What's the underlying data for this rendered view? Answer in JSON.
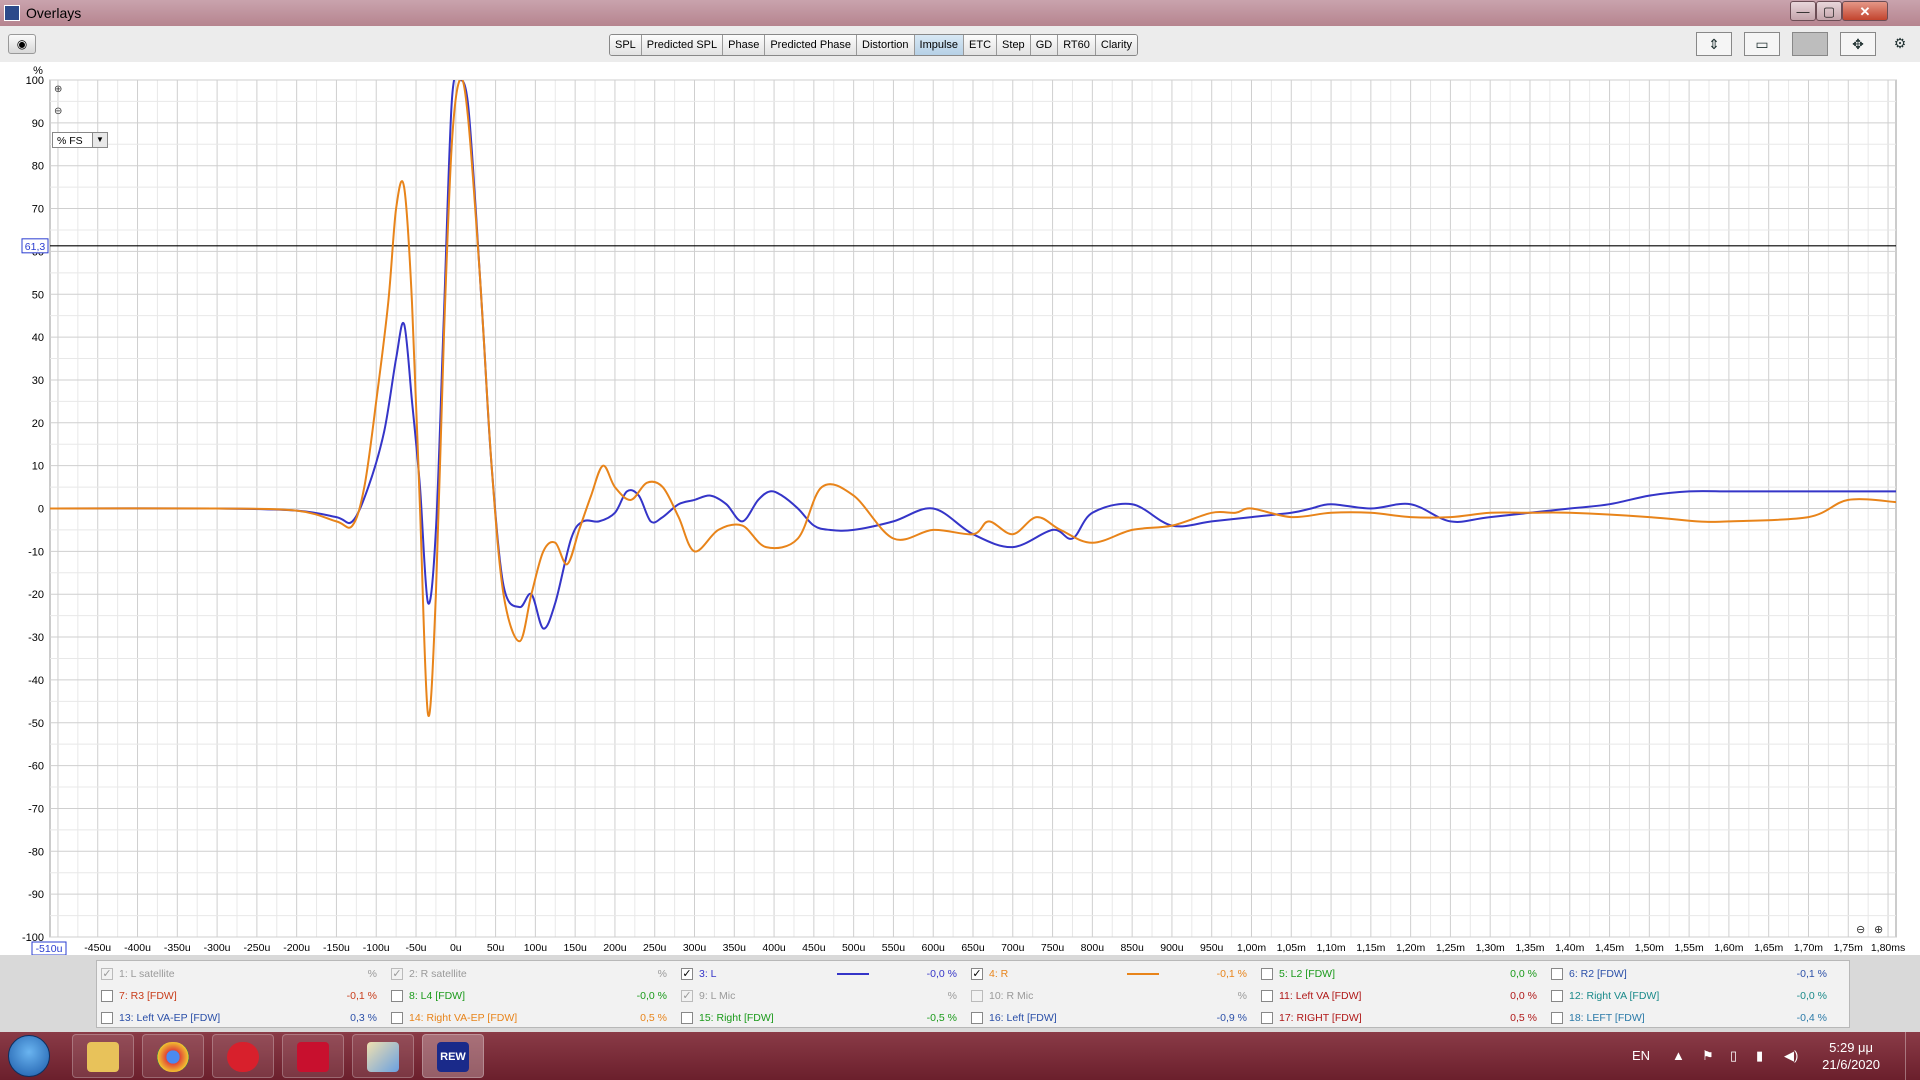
{
  "window": {
    "title": "Overlays",
    "minimize": "—",
    "maximize": "▢",
    "close": "✕"
  },
  "toolbar": {
    "tabs": [
      {
        "label": "SPL"
      },
      {
        "label": "Predicted SPL"
      },
      {
        "label": "Phase"
      },
      {
        "label": "Predicted Phase"
      },
      {
        "label": "Distortion"
      },
      {
        "label": "Impulse",
        "active": true
      },
      {
        "label": "ETC"
      },
      {
        "label": "Step"
      },
      {
        "label": "GD"
      },
      {
        "label": "RT60"
      },
      {
        "label": "Clarity"
      }
    ]
  },
  "graph": {
    "y_unit_label": "%",
    "y_mode": "% FS",
    "cursor_value": "61,3",
    "x_start_label": "-510u"
  },
  "chart_data": {
    "type": "line",
    "xlabel": "",
    "ylabel": "%",
    "xlim": [
      -510,
      1810
    ],
    "ylim": [
      -100,
      100
    ],
    "x_unit": "microseconds",
    "cursor_y": 61.3,
    "grid": true,
    "y_ticks": [
      "100",
      "90",
      "80",
      "70",
      "60",
      "50",
      "40",
      "30",
      "20",
      "10",
      "0",
      "-10",
      "-20",
      "-30",
      "-40",
      "-50",
      "-60",
      "-70",
      "-80",
      "-90",
      "-100"
    ],
    "x_tick_labels": [
      "-450u",
      "-400u",
      "-350u",
      "-300u",
      "-250u",
      "-200u",
      "-150u",
      "-100u",
      "-50u",
      "0u",
      "50u",
      "100u",
      "150u",
      "200u",
      "250u",
      "300u",
      "350u",
      "400u",
      "450u",
      "500u",
      "550u",
      "600u",
      "650u",
      "700u",
      "750u",
      "800u",
      "850u",
      "900u",
      "950u",
      "1,00m",
      "1,05m",
      "1,10m",
      "1,15m",
      "1,20m",
      "1,25m",
      "1,30m",
      "1,35m",
      "1,40m",
      "1,45m",
      "1,50m",
      "1,55m",
      "1,60m",
      "1,65m",
      "1,70m",
      "1,75m",
      "1,80ms"
    ],
    "series": [
      {
        "name": "3: L",
        "color": "#3535c8",
        "x": [
          -510,
          -300,
          -200,
          -150,
          -130,
          -110,
          -90,
          -75,
          -65,
          -55,
          -45,
          -35,
          -25,
          -15,
          -5,
          5,
          15,
          25,
          35,
          45,
          60,
          80,
          95,
          110,
          125,
          145,
          160,
          180,
          200,
          215,
          230,
          245,
          260,
          280,
          300,
          320,
          340,
          360,
          380,
          395,
          410,
          430,
          450,
          470,
          500,
          550,
          600,
          650,
          700,
          750,
          775,
          800,
          850,
          900,
          950,
          1000,
          1050,
          1075,
          1100,
          1150,
          1200,
          1250,
          1300,
          1400,
          1450,
          1500,
          1550,
          1600,
          1650,
          1700,
          1750,
          1810
        ],
        "y": [
          0,
          0,
          -0.5,
          -2,
          -3,
          5,
          18,
          35,
          43,
          25,
          5,
          -22,
          -5,
          45,
          95,
          100,
          95,
          70,
          40,
          10,
          -18,
          -23,
          -20,
          -28,
          -22,
          -7,
          -3,
          -3,
          -1,
          4,
          3,
          -3,
          -2,
          1,
          2,
          3,
          1,
          -3,
          2,
          4,
          3,
          0,
          -4,
          -5,
          -5,
          -3,
          0,
          -6,
          -9,
          -5,
          -7,
          -1,
          1,
          -4,
          -3,
          -2,
          -1,
          0,
          1,
          0,
          1,
          -3,
          -2,
          0,
          1,
          3,
          4,
          4,
          4,
          4,
          4,
          4
        ]
      },
      {
        "name": "4: R",
        "color": "#e8841a",
        "x": [
          -510,
          -300,
          -200,
          -150,
          -130,
          -115,
          -100,
          -85,
          -75,
          -65,
          -55,
          -45,
          -35,
          -25,
          -15,
          -5,
          5,
          15,
          30,
          45,
          60,
          80,
          95,
          110,
          125,
          140,
          155,
          170,
          185,
          200,
          220,
          240,
          260,
          280,
          300,
          330,
          360,
          390,
          430,
          460,
          500,
          550,
          600,
          650,
          670,
          700,
          730,
          760,
          800,
          850,
          900,
          950,
          980,
          1000,
          1050,
          1100,
          1150,
          1200,
          1250,
          1300,
          1350,
          1400,
          1500,
          1560,
          1600,
          1700,
          1750,
          1810
        ],
        "y": [
          0,
          0,
          -0.5,
          -3,
          -4,
          5,
          25,
          48,
          70,
          75,
          48,
          0,
          -48,
          -20,
          40,
          85,
          100,
          92,
          55,
          10,
          -20,
          -31,
          -20,
          -10,
          -8,
          -13,
          -5,
          3,
          10,
          5,
          2,
          6,
          5,
          -2,
          -10,
          -5,
          -4,
          -9,
          -7,
          5,
          3,
          -7,
          -5,
          -6,
          -3,
          -6,
          -2,
          -5,
          -8,
          -5,
          -4,
          -1,
          -1,
          0,
          -2,
          -1,
          -1,
          -2,
          -2,
          -1,
          -1,
          -1,
          -2,
          -3,
          -3,
          -2,
          2,
          1.5
        ]
      }
    ]
  },
  "legend": {
    "items": [
      {
        "label": "1: L satellite",
        "value": "%",
        "color": "#9a9a9a",
        "checked": true,
        "enabled": false
      },
      {
        "label": "2: R satellite",
        "value": "%",
        "color": "#9a9a9a",
        "checked": true,
        "enabled": false
      },
      {
        "label": "3: L",
        "value": "-0,0 %",
        "color": "#3535c8",
        "checked": true,
        "enabled": true,
        "line": true
      },
      {
        "label": "4: R",
        "value": "-0,1 %",
        "color": "#e8841a",
        "checked": true,
        "enabled": true,
        "line": true
      },
      {
        "label": "5: L2 [FDW]",
        "value": "0,0 %",
        "color": "#1a9a1a",
        "checked": false,
        "enabled": true
      },
      {
        "label": "6: R2 [FDW]",
        "value": "-0,1 %",
        "color": "#2a4fa8",
        "checked": false,
        "enabled": true
      },
      {
        "label": "7: R3 [FDW]",
        "value": "-0,1 %",
        "color": "#c83c1a",
        "checked": false,
        "enabled": true
      },
      {
        "label": "8: L4 [FDW]",
        "value": "-0,0 %",
        "color": "#1a9a1a",
        "checked": false,
        "enabled": true
      },
      {
        "label": "9: L Mic",
        "value": "%",
        "color": "#9a9a9a",
        "checked": true,
        "enabled": false
      },
      {
        "label": "10: R Mic",
        "value": "%",
        "color": "#9a9a9a",
        "checked": false,
        "enabled": false
      },
      {
        "label": "11: Left VA [FDW]",
        "value": "0,0 %",
        "color": "#b01818",
        "checked": false,
        "enabled": true
      },
      {
        "label": "12: Right VA [FDW]",
        "value": "-0,0 %",
        "color": "#1a8a8a",
        "checked": false,
        "enabled": true
      },
      {
        "label": "13: Left VA-EP [FDW]",
        "value": "0,3 %",
        "color": "#2a4fa8",
        "checked": false,
        "enabled": true
      },
      {
        "label": "14: Right VA-EP [FDW]",
        "value": "0,5 %",
        "color": "#e8841a",
        "checked": false,
        "enabled": true
      },
      {
        "label": "15: Right [FDW]",
        "value": "-0,5 %",
        "color": "#1a9a1a",
        "checked": false,
        "enabled": true
      },
      {
        "label": "16: Left [FDW]",
        "value": "-0,9 %",
        "color": "#2a4fa8",
        "checked": false,
        "enabled": true
      },
      {
        "label": "17: RIGHT [FDW]",
        "value": "0,5 %",
        "color": "#b01818",
        "checked": false,
        "enabled": true
      },
      {
        "label": "18: LEFT [FDW]",
        "value": "-0,4 %",
        "color": "#2a7aa8",
        "checked": false,
        "enabled": true
      }
    ]
  },
  "taskbar": {
    "rew_label": "REW",
    "language": "EN",
    "time": "5:29 μμ",
    "date": "21/6/2020"
  }
}
